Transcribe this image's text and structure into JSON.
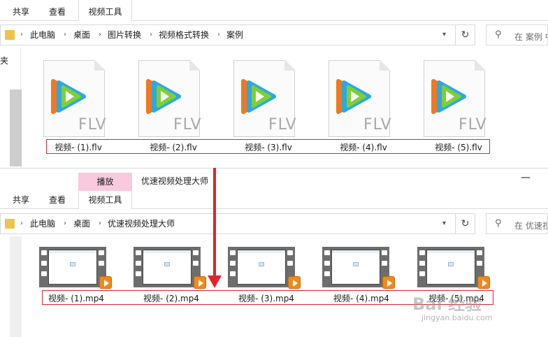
{
  "top_window": {
    "ribbon_tabs": [
      "共享",
      "查看",
      "视频工具"
    ],
    "breadcrumb": [
      "此电脑",
      "桌面",
      "图片转换",
      "视频格式转换",
      "案例"
    ],
    "search_placeholder": "在 案例 中",
    "nav_fragment": "夹",
    "file_badge": "FLV",
    "files": [
      "视频- (1).flv",
      "视频- (2).flv",
      "视频- (3).flv",
      "视频- (4).flv",
      "视频- (5).flv"
    ]
  },
  "bottom_window": {
    "context_tab": "播放",
    "title": "优速视频处理大师",
    "minimize_symbol": "—",
    "ribbon_tabs": [
      "共享",
      "查看",
      "视频工具"
    ],
    "breadcrumb": [
      "此电脑",
      "桌面",
      "优速视频处理大师"
    ],
    "search_placeholder": "在 优速视",
    "files": [
      "视频- (1).mp4",
      "视频- (2).mp4",
      "视频- (3).mp4",
      "视频- (4).mp4",
      "视频- (5).mp4"
    ]
  },
  "watermark": {
    "main": "Bai 经验",
    "sub": "jingyan.baidu.com"
  },
  "colors": {
    "highlight_red": "#e0242c",
    "context_pink": "#f9c9de",
    "folder_yellow": "#f0c34a"
  },
  "icons": {
    "folder": "folder-icon",
    "refresh": "refresh-icon",
    "search": "search-icon",
    "flv_file": "tencent-video-flv-file-icon",
    "mp4_file": "video-film-thumbnail-icon"
  }
}
